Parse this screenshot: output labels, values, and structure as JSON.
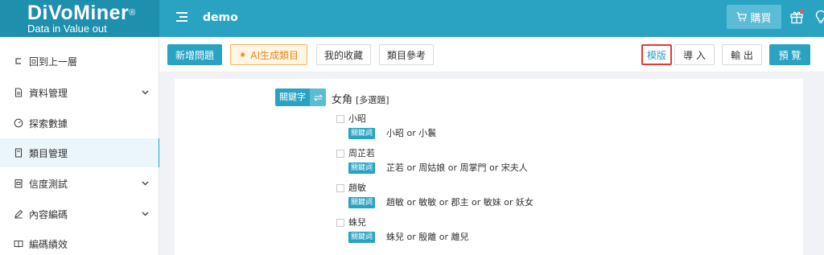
{
  "header": {
    "logo_main": "DiVoMiner",
    "logo_reg": "®",
    "logo_sub": "Data in  Value out",
    "project_name": "demo",
    "buy_label": "購買",
    "icons": {
      "menu": "menu-indent-icon",
      "cart": "cart-icon",
      "gift": "gift-icon",
      "bulb": "lightbulb-icon"
    },
    "colors": {
      "header_bg": "#2aa3c3",
      "logo_bg": "#1f8fae",
      "notification_dot": "#ff4d4f"
    }
  },
  "sidebar": {
    "items": [
      {
        "label": "回到上一層",
        "icon": "return-icon",
        "has_arrow": false,
        "active": false
      },
      {
        "label": "資料管理",
        "icon": "document-icon",
        "has_arrow": true,
        "active": false
      },
      {
        "label": "探索數據",
        "icon": "gauge-icon",
        "has_arrow": false,
        "active": false
      },
      {
        "label": "類目管理",
        "icon": "file-icon",
        "has_arrow": false,
        "active": true
      },
      {
        "label": "信度測試",
        "icon": "clipboard-icon",
        "has_arrow": true,
        "active": false
      },
      {
        "label": "內容編碼",
        "icon": "pen-icon",
        "has_arrow": true,
        "active": false
      },
      {
        "label": "編碼績效",
        "icon": "book-icon",
        "has_arrow": false,
        "active": false
      }
    ]
  },
  "toolbar": {
    "add_question": "新增問題",
    "ai_generate": "AI生成類目",
    "my_favorites": "我的收藏",
    "category_reference": "類目參考",
    "template": "模版",
    "import": "導 入",
    "export": "輸 出",
    "preview": "預 覽"
  },
  "question": {
    "keyword_tag": "關鍵字",
    "title": "女角",
    "type": "[多選題]",
    "options": [
      {
        "label": "小昭",
        "kw_tag": "關鍵詞",
        "expression": "小昭 or 小鬟"
      },
      {
        "label": "周芷若",
        "kw_tag": "關鍵詞",
        "expression": "芷若 or 周姑娘 or 周掌門 or 宋夫人"
      },
      {
        "label": "趙敏",
        "kw_tag": "關鍵詞",
        "expression": "趙敏 or 敏敏 or 郡主 or 敏妹 or 妖女"
      },
      {
        "label": "蛛兒",
        "kw_tag": "關鍵詞",
        "expression": "蛛兒 or 殷離 or 離兒"
      }
    ]
  }
}
